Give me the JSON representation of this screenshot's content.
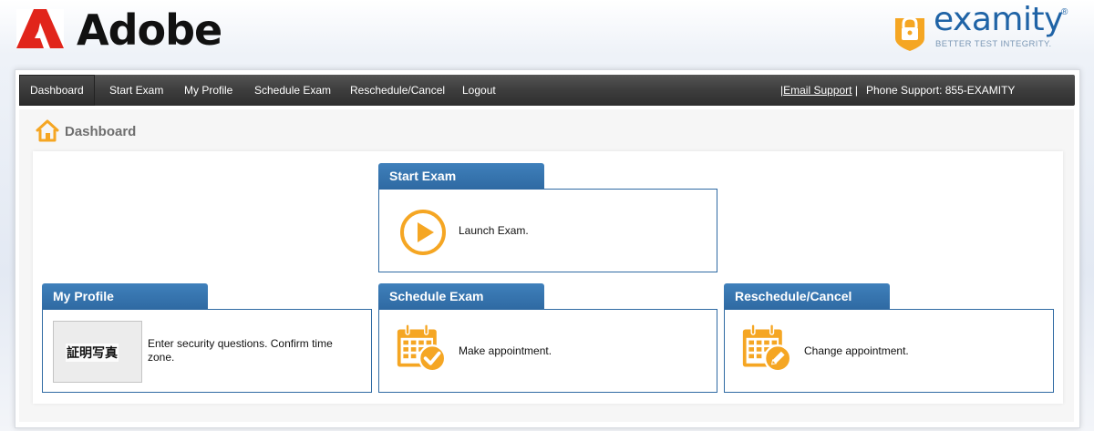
{
  "header": {
    "adobe_brand": "Adobe",
    "examity_brand": "examity",
    "examity_registered": "®",
    "examity_tagline": "BETTER TEST INTEGRITY."
  },
  "nav": {
    "items": [
      {
        "label": "Dashboard",
        "active": true
      },
      {
        "label": "Start Exam",
        "active": false
      },
      {
        "label": "My Profile",
        "active": false
      },
      {
        "label": "Schedule Exam",
        "active": false
      },
      {
        "label": "Reschedule/Cancel",
        "active": false
      },
      {
        "label": "Logout",
        "active": false
      }
    ],
    "email_prefix": "|",
    "email_support": "Email Support",
    "email_suffix": " |",
    "phone_support": "Phone Support: 855-EXAMITY"
  },
  "breadcrumb": {
    "title": "Dashboard",
    "icon": "home-icon"
  },
  "cards": {
    "start_exam": {
      "title": "Start Exam",
      "text": "Launch Exam.",
      "icon": "play-icon"
    },
    "my_profile": {
      "title": "My Profile",
      "text": "Enter security questions. Confirm time zone.",
      "photo_label": "証明写真",
      "icon": "id-photo"
    },
    "schedule_exam": {
      "title": "Schedule Exam",
      "text": "Make appointment.",
      "icon": "calendar-check-icon"
    },
    "reschedule_cancel": {
      "title": "Reschedule/Cancel",
      "text": "Change appointment.",
      "icon": "calendar-edit-icon"
    }
  },
  "colors": {
    "accent_blue": "#2f6aa3",
    "icon_orange": "#f5a623",
    "nav_dark": "#3d3d3d"
  }
}
